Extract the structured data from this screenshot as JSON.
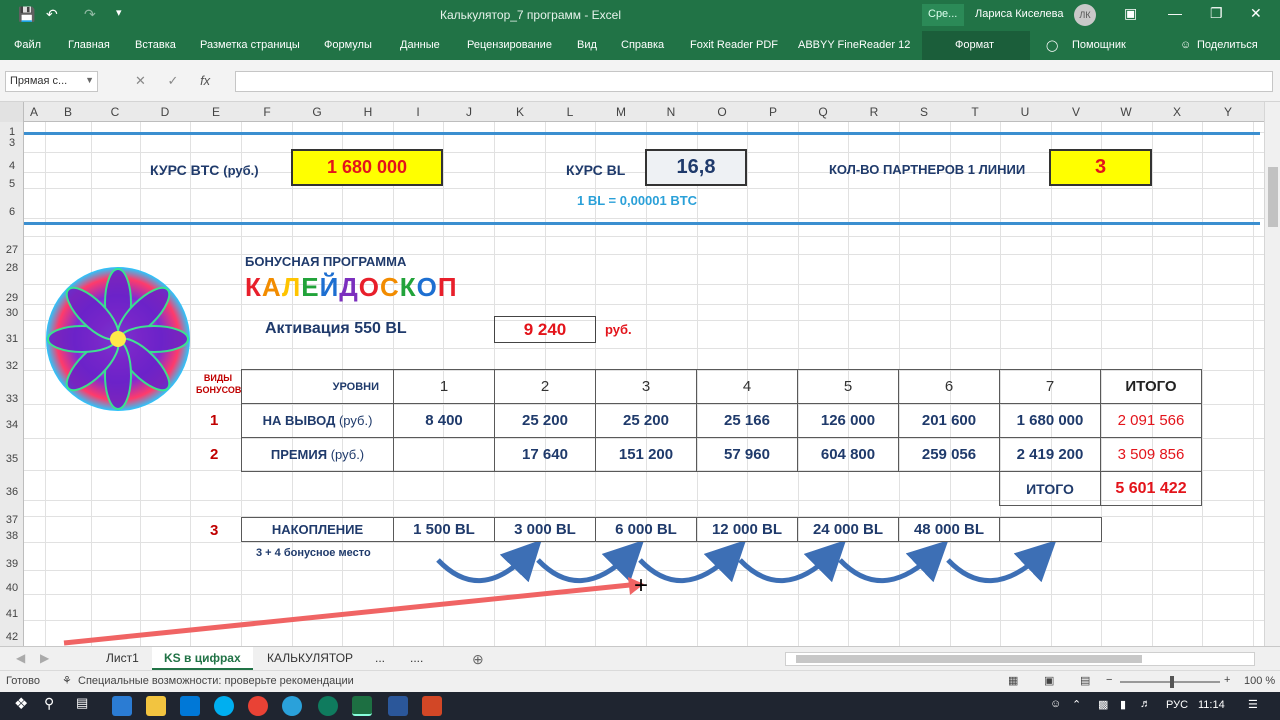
{
  "window": {
    "title": "Калькулятор_7 программ  -  Excel",
    "search_label": "Сре...",
    "user_name": "Лариса Киселева",
    "user_initials": "ЛК"
  },
  "menu": {
    "items": [
      "Файл",
      "Главная",
      "Вставка",
      "Разметка страницы",
      "Формулы",
      "Данные",
      "Рецензирование",
      "Вид",
      "Справка",
      "Foxit Reader PDF",
      "ABBYY FineReader 12"
    ],
    "format_label": "Формат",
    "helper_label": "Помощник",
    "share_label": "Поделиться"
  },
  "formula_bar": {
    "name_box": "Прямая с...",
    "cancel": "✕",
    "enter": "✓",
    "fx": "fx",
    "value": ""
  },
  "columns": [
    "A",
    "B",
    "C",
    "D",
    "E",
    "F",
    "G",
    "H",
    "I",
    "J",
    "K",
    "L",
    "M",
    "N",
    "O",
    "P",
    "Q",
    "R",
    "S",
    "T",
    "U",
    "V",
    "W",
    "X",
    "Y"
  ],
  "rows": [
    "1",
    "3",
    "4",
    "5",
    "6",
    "27",
    "28",
    "29",
    "30",
    "31",
    "32",
    "33",
    "34",
    "35",
    "36",
    "37",
    "38",
    "39",
    "40",
    "41",
    "42"
  ],
  "header_block": {
    "btc_label": "КУРС BTC",
    "btc_unit": "(руб.)",
    "btc_value": "1 680 000",
    "bl_label": "КУРС BL",
    "bl_value": "16,8",
    "bl_note": "1 BL = 0,00001 BTC",
    "partners_label": "КОЛ-ВО ПАРТНЕРОВ 1 ЛИНИИ",
    "partners_value": "3"
  },
  "program": {
    "subtitle": "БОНУСНАЯ ПРОГРАММА",
    "name_letters": [
      "К",
      "А",
      "Л",
      "Е",
      "Й",
      "Д",
      "О",
      "С",
      "К",
      "О",
      "П"
    ],
    "name_colors": [
      "#e81f2b",
      "#f28c00",
      "#ffc400",
      "#22a33a",
      "#1d6fd1",
      "#7b2fbe",
      "#e81f2b",
      "#f28c00",
      "#22a33a",
      "#1d6fd1",
      "#e81f2b"
    ],
    "activation_label": "Активация  550 BL",
    "activation_value": "9 240",
    "activation_unit": "руб."
  },
  "table": {
    "kinds_label": "ВИДЫ БОНУСОВ",
    "levels_label": "УРОВНИ",
    "levels": [
      "1",
      "2",
      "3",
      "4",
      "5",
      "6",
      "7"
    ],
    "total_label": "ИТОГО",
    "rows": [
      {
        "num": "1",
        "label": "НА ВЫВОД",
        "unit": "(руб.)",
        "values": [
          "8 400",
          "25 200",
          "25 200",
          "25 166",
          "126 000",
          "201 600",
          "1 680 000"
        ],
        "total": "2 091 566"
      },
      {
        "num": "2",
        "label": "ПРЕМИЯ",
        "unit": "(руб.)",
        "values": [
          "",
          "17 640",
          "151 200",
          "57 960",
          "604 800",
          "259 056",
          "2 419 200"
        ],
        "total": "3 509 856"
      }
    ],
    "grand_total_label": "ИТОГО",
    "grand_total": "5 601 422"
  },
  "accumulation": {
    "num": "3",
    "label": "НАКОПЛЕНИЕ",
    "values": [
      "1 500 BL",
      "3 000 BL",
      "6 000 BL",
      "12 000 BL",
      "24 000 BL",
      "48 000 BL",
      ""
    ],
    "note": "3 + 4 бонусное место"
  },
  "sheet_tabs": [
    "Лист1",
    "KS в цифрах",
    "КАЛЬКУЛЯТОР",
    "...",
    "...."
  ],
  "status": {
    "ready": "Готово",
    "accessibility": "Специальные возможности: проверьте рекомендации",
    "zoom": "100 %"
  },
  "taskbar": {
    "lang": "РУС",
    "time": "11:14"
  },
  "colors": {
    "excel_green": "#217346",
    "yellow_fill": "#ffff00",
    "value_red": "#e3141b",
    "label_navy": "#1f3a6b",
    "accent_blue": "#3b8fd0",
    "arrow_red": "#f06464"
  }
}
